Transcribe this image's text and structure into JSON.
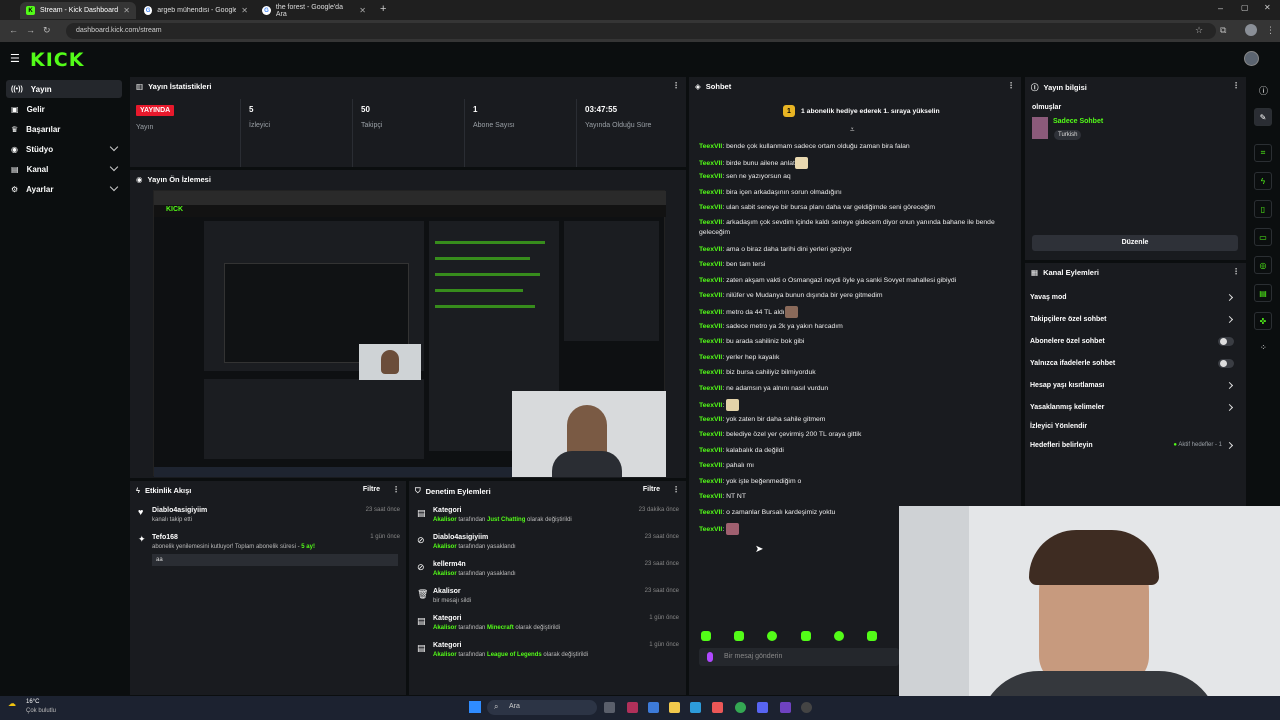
{
  "browser": {
    "tabs": [
      {
        "label": "Stream - Kick Dashboard",
        "active": true
      },
      {
        "label": "argeb mühendisi - Google'da A"
      },
      {
        "label": "the forest - Google'da Ara"
      }
    ],
    "url": "dashboard.kick.com/stream"
  },
  "header": {
    "logo": "KICK"
  },
  "sidebar": {
    "items": [
      {
        "label": "Yayın",
        "active": true
      },
      {
        "label": "Gelir"
      },
      {
        "label": "Başarılar"
      },
      {
        "label": "Stüdyo"
      },
      {
        "label": "Kanal"
      },
      {
        "label": "Ayarlar"
      }
    ]
  },
  "stats": {
    "title": "Yayın İstatistikleri",
    "live_badge": "YAYINDA",
    "live_label": "Yayın",
    "viewers": {
      "value": "5",
      "label": "İzleyici"
    },
    "followers": {
      "value": "50",
      "label": "Takipçi"
    },
    "subs": {
      "value": "1",
      "label": "Abone Sayısı"
    },
    "duration": {
      "value": "03:47:55",
      "label": "Yayında Olduğu Süre"
    }
  },
  "preview": {
    "title": "Yayın Ön İzlemesi"
  },
  "activity": {
    "title": "Etkinlik Akışı",
    "filter": "Filtre",
    "events": [
      {
        "user": "Diablo4asigiyiim",
        "text": "kanalı takip etti",
        "time": "23 saat önce"
      },
      {
        "user": "Tefo168",
        "text": "abonelik yenilemesini kutluyor! Toplam abonelik süresi - ",
        "months": "5 ay!",
        "message": "aa",
        "time": "1 gün önce"
      }
    ]
  },
  "moderation": {
    "title": "Denetim Eylemleri",
    "filter": "Filtre",
    "items": [
      {
        "title": "Kategori",
        "actor": "Akalisor",
        "mid": " tarafından ",
        "target": "Just Chatting",
        "end": " olarak değiştirildi",
        "time": "23 dakika önce"
      },
      {
        "title": "Diablo4asigiyiim",
        "actor": "Akalisor",
        "mid": " tarafından yasaklandı",
        "target": "",
        "end": "",
        "time": "23 saat önce"
      },
      {
        "title": "kellerm4n",
        "actor": "Akalisor",
        "mid": " tarafından yasaklandı",
        "target": "",
        "end": "",
        "time": "23 saat önce"
      },
      {
        "title": "Akalisor",
        "actor": "",
        "mid": "bir mesajı sildi",
        "target": "",
        "end": "",
        "time": "23 saat önce"
      },
      {
        "title": "Kategori",
        "actor": "Akalisor",
        "mid": " tarafından ",
        "target": "Minecraft",
        "end": " olarak değiştirildi",
        "time": "1 gün önce"
      },
      {
        "title": "Kategori",
        "actor": "Akalisor",
        "mid": " tarafından ",
        "target": "League of Legends",
        "end": " olarak değiştirildi",
        "time": "1 gün önce"
      }
    ]
  },
  "chat": {
    "title": "Sohbet",
    "pinned": "1 abonelik hediye ederek 1. sıraya yükselin",
    "user": "TeexVII",
    "messages": [
      "bende çok kullanmam sadece ortam olduğu zaman bira falan",
      "birde bunu ailene anlat",
      "sen ne yazıyorsun aq",
      "bira içen arkadaşının sorun olmadığını",
      "ulan sabit seneye bir bursa planı daha var geldiğimde seni göreceğim",
      "arkadaşım çok sevdim içinde kaldı seneye gidecem diyor onun yanında bahane ile bende geleceğim",
      "ama o biraz daha tarihi dini yerleri geziyor",
      "ben tam tersi",
      "zaten akşam vakti o Osmangazi neydi öyle ya sanki Sovyet mahallesi gibiydi",
      "nilüfer ve Mudanya bunun dışında bir yere gitmedim",
      "metro da 44 TL aldı",
      "sadece metro ya 2k ya yakın harcadım",
      "bu arada sahiliniz bok gibi",
      "yerler hep kayalık",
      "biz bursa cahiliyiz bilmiyorduk",
      "ne adamsın ya alnını nasıl vurdun",
      "",
      "yok zaten bir daha sahile gitmem",
      "belediye özel yer çevirmiş 200 TL oraya gittik",
      "kalabalık da değildi",
      "pahalı mı",
      "yok işte beğenmediğim o",
      "NT NT",
      "o zamanlar Bursalı kardeşimiz yoktu",
      ""
    ],
    "input_placeholder": "Bir mesaj gönderin"
  },
  "stream_info": {
    "title": "Yayın bilgisi",
    "stream_title": "olmuşlar",
    "category": "Sadece Sohbet",
    "language": "Turkish",
    "edit_button": "Düzenle"
  },
  "channel_actions": {
    "title": "Kanal Eylemleri",
    "items": [
      {
        "label": "Yavaş mod",
        "type": "arrow"
      },
      {
        "label": "Takipçilere özel sohbet",
        "type": "arrow"
      },
      {
        "label": "Abonelere özel sohbet",
        "type": "toggle"
      },
      {
        "label": "Yalnızca ifadelerle sohbet",
        "type": "toggle"
      },
      {
        "label": "Hesap yaşı kısıtlaması",
        "type": "arrow"
      },
      {
        "label": "Yasaklanmış kelimeler",
        "type": "arrow"
      },
      {
        "label": "İzleyici Yönlendir",
        "type": "none"
      },
      {
        "label": "Hedefleri belirleyin",
        "type": "goal"
      }
    ],
    "goal_status": "Aktif hedefler - 1"
  },
  "taskbar": {
    "weather_temp": "16°C",
    "weather_desc": "Çok bulutlu",
    "search": "Ara"
  },
  "colors": {
    "accent": "#53fc18",
    "live": "#e8192c",
    "panel": "#191b1f",
    "bg": "#0b0e0f"
  }
}
